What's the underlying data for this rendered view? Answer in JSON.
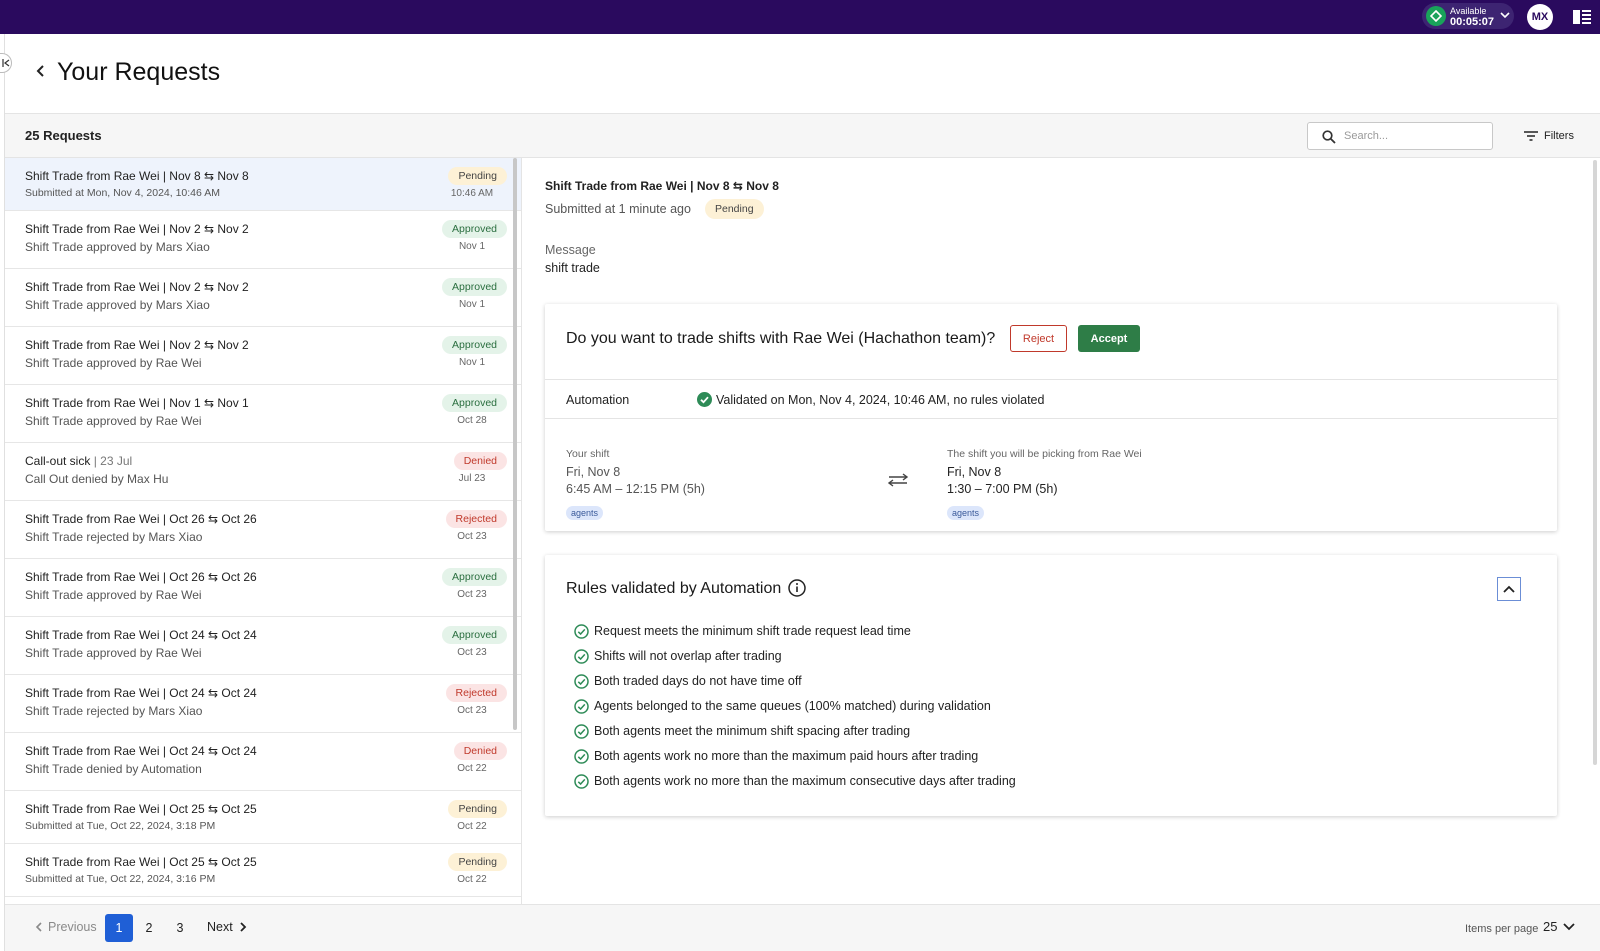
{
  "topbar": {
    "status_label": "Available",
    "status_timer": "00:05:07",
    "avatar_initials": "MX",
    "colors": {
      "background": "#2a0a5e",
      "status_dot": "#19a35a"
    }
  },
  "header": {
    "title": "Your Requests"
  },
  "toolbar": {
    "request_count": "25 Requests",
    "search_placeholder": "Search...",
    "filters_label": "Filters"
  },
  "requests": [
    {
      "title": "Shift Trade from Rae Wei | Nov 8 ⇆ Nov 8",
      "subtitle": "Submitted at Mon, Nov 4, 2024, 10:46 AM",
      "status": "Pending",
      "date": "10:46 AM"
    },
    {
      "title": "Shift Trade from Rae Wei | Nov 2 ⇆ Nov 2",
      "subtitle": "Shift Trade approved by Mars Xiao",
      "status": "Approved",
      "date": "Nov 1"
    },
    {
      "title": "Shift Trade from Rae Wei | Nov 2 ⇆ Nov 2",
      "subtitle": "Shift Trade approved by Mars Xiao",
      "status": "Approved",
      "date": "Nov 1"
    },
    {
      "title": "Shift Trade from Rae Wei | Nov 2 ⇆ Nov 2",
      "subtitle": "Shift Trade approved by Rae Wei",
      "status": "Approved",
      "date": "Nov 1"
    },
    {
      "title": "Shift Trade from Rae Wei | Nov 1 ⇆ Nov 1",
      "subtitle": "Shift Trade approved by Rae Wei",
      "status": "Approved",
      "date": "Oct 28"
    },
    {
      "title": "Call-out sick",
      "title_suffix": "| 23 Jul",
      "subtitle": "Call Out denied by Max Hu",
      "status": "Denied",
      "date": "Jul 23"
    },
    {
      "title": "Shift Trade from Rae Wei | Oct 26 ⇆ Oct 26",
      "subtitle": "Shift Trade rejected by Mars Xiao",
      "status": "Rejected",
      "date": "Oct 23"
    },
    {
      "title": "Shift Trade from Rae Wei | Oct 26 ⇆ Oct 26",
      "subtitle": "Shift Trade approved by Rae Wei",
      "status": "Approved",
      "date": "Oct 23"
    },
    {
      "title": "Shift Trade from Rae Wei | Oct 24 ⇆ Oct 24",
      "subtitle": "Shift Trade approved by Rae Wei",
      "status": "Approved",
      "date": "Oct 23"
    },
    {
      "title": "Shift Trade from Rae Wei | Oct 24 ⇆ Oct 24",
      "subtitle": "Shift Trade rejected by Mars Xiao",
      "status": "Rejected",
      "date": "Oct 23"
    },
    {
      "title": "Shift Trade from Rae Wei | Oct 24 ⇆ Oct 24",
      "subtitle": "Shift Trade denied by Automation",
      "status": "Denied",
      "date": "Oct 22"
    },
    {
      "title": "Shift Trade from Rae Wei | Oct 25 ⇆ Oct 25",
      "subtitle": "Submitted at Tue, Oct 22, 2024, 3:18 PM",
      "status": "Pending",
      "date": "Oct 22"
    },
    {
      "title": "Shift Trade from Rae Wei | Oct 25 ⇆ Oct 25",
      "subtitle": "Submitted at Tue, Oct 22, 2024, 3:16 PM",
      "status": "Pending",
      "date": "Oct 22"
    }
  ],
  "detail": {
    "title": "Shift Trade from Rae Wei | Nov 8 ⇆ Nov 8",
    "submitted": "Submitted at 1 minute ago",
    "status": "Pending",
    "message_label": "Message",
    "message": "shift trade",
    "question": "Do you want to trade shifts with Rae Wei (Hachathon team)?",
    "reject_label": "Reject",
    "accept_label": "Accept",
    "automation_label": "Automation",
    "automation_text": "Validated on Mon, Nov 4, 2024, 10:46 AM, no rules violated",
    "your_shift": {
      "label": "Your shift",
      "day": "Fri, Nov 8",
      "time": "6:45 AM – 12:15 PM (5h)",
      "tag": "agents"
    },
    "their_shift": {
      "label": "The shift you will be picking from Rae Wei",
      "day": "Fri, Nov 8",
      "time": "1:30 – 7:00 PM (5h)",
      "tag": "agents"
    },
    "rules_title": "Rules validated by Automation",
    "rules": [
      "Request meets the minimum shift trade request lead time",
      "Shifts will not overlap after trading",
      "Both traded days do not have time off",
      "Agents belonged to the same queues (100% matched) during validation",
      "Both agents meet the minimum shift spacing after trading",
      "Both agents work no more than the maximum paid hours after trading",
      "Both agents work no more than the maximum consecutive days after trading"
    ],
    "colors": {
      "accept": "#2e7d47",
      "reject": "#c0392b",
      "check": "#2e8b57"
    }
  },
  "pagination": {
    "previous_label": "Previous",
    "pages": [
      "1",
      "2",
      "3"
    ],
    "active_page": "1",
    "next_label": "Next",
    "items_per_page_label": "Items per page",
    "items_per_page_value": "25"
  }
}
